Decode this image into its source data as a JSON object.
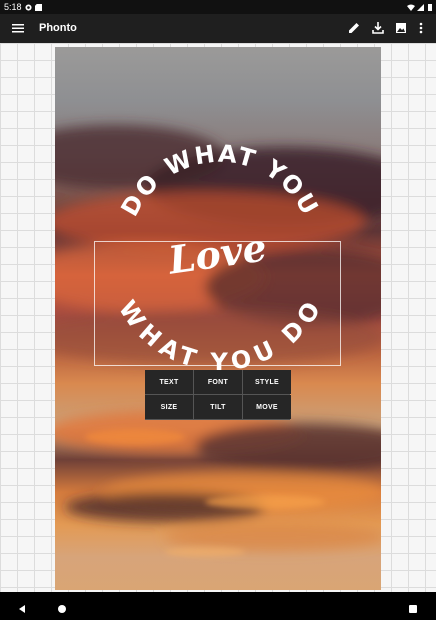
{
  "status_bar": {
    "time": "5:18",
    "icons": [
      "hotspot-icon",
      "sd-card-icon",
      "wifi-icon",
      "signal-icon",
      "battery-icon"
    ]
  },
  "app_bar": {
    "title": "Phonto",
    "actions": [
      "menu-icon",
      "pencil-icon",
      "download-icon",
      "image-icon",
      "more-vert-icon"
    ]
  },
  "artwork": {
    "arc_top": "DO WHAT YOU",
    "arc_bottom": "WHAT YOU DO",
    "script_text": "Love"
  },
  "text_toolbar": {
    "buttons": [
      {
        "label": "TEXT"
      },
      {
        "label": "FONT"
      },
      {
        "label": "STYLE"
      },
      {
        "label": "SIZE"
      },
      {
        "label": "TILT"
      },
      {
        "label": "MOVE"
      }
    ]
  },
  "navigation": {
    "buttons": [
      "back-icon",
      "home-icon",
      "recents-icon"
    ]
  },
  "colors": {
    "app_bar": "#1f1f1f",
    "status_bar": "#111111",
    "toolbar_button": "#262626",
    "text": "#ffffff"
  }
}
